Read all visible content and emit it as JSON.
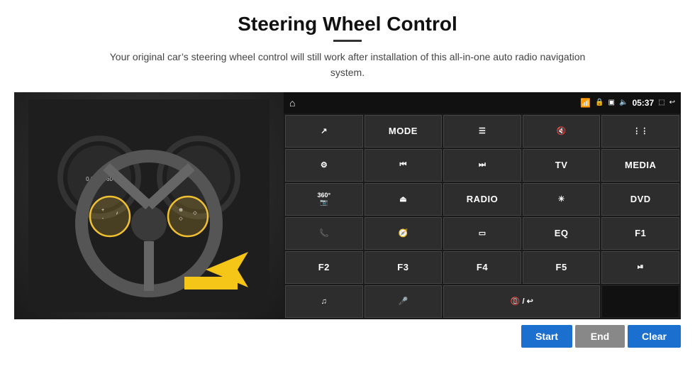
{
  "page": {
    "title": "Steering Wheel Control",
    "subtitle": "Your original car’s steering wheel control will still work after installation of this all-in-one auto radio navigation system."
  },
  "status_bar": {
    "time": "05:37",
    "icons": [
      "wifi",
      "lock",
      "sim",
      "bluetooth",
      "screenshot",
      "back"
    ]
  },
  "buttons": [
    {
      "id": "nav",
      "label": "",
      "icon": "arrow-up-right"
    },
    {
      "id": "mode",
      "label": "MODE",
      "icon": ""
    },
    {
      "id": "menu",
      "label": "",
      "icon": "list"
    },
    {
      "id": "mute",
      "label": "",
      "icon": "mute"
    },
    {
      "id": "apps",
      "label": "",
      "icon": "apps"
    },
    {
      "id": "settings",
      "label": "",
      "icon": "gear"
    },
    {
      "id": "prev",
      "label": "",
      "icon": "prev"
    },
    {
      "id": "next",
      "label": "",
      "icon": "next"
    },
    {
      "id": "tv",
      "label": "TV",
      "icon": ""
    },
    {
      "id": "media",
      "label": "MEDIA",
      "icon": ""
    },
    {
      "id": "cam360",
      "label": "",
      "icon": "cam360"
    },
    {
      "id": "eject",
      "label": "",
      "icon": "eject"
    },
    {
      "id": "radio",
      "label": "RADIO",
      "icon": ""
    },
    {
      "id": "brightness",
      "label": "",
      "icon": "sun"
    },
    {
      "id": "dvd",
      "label": "DVD",
      "icon": ""
    },
    {
      "id": "phone",
      "label": "",
      "icon": "phone"
    },
    {
      "id": "nav2",
      "label": "",
      "icon": "nav"
    },
    {
      "id": "window",
      "label": "",
      "icon": "window"
    },
    {
      "id": "eq",
      "label": "EQ",
      "icon": ""
    },
    {
      "id": "f1",
      "label": "F1",
      "icon": ""
    },
    {
      "id": "f2",
      "label": "F2",
      "icon": ""
    },
    {
      "id": "f3",
      "label": "F3",
      "icon": ""
    },
    {
      "id": "f4",
      "label": "F4",
      "icon": ""
    },
    {
      "id": "f5",
      "label": "F5",
      "icon": ""
    },
    {
      "id": "play-pause",
      "label": "",
      "icon": "play-pause"
    },
    {
      "id": "music",
      "label": "",
      "icon": "music"
    },
    {
      "id": "mic",
      "label": "",
      "icon": "mic"
    },
    {
      "id": "call-end",
      "label": "",
      "icon": "call-end"
    }
  ],
  "action_buttons": {
    "start": "Start",
    "end": "End",
    "clear": "Clear"
  }
}
